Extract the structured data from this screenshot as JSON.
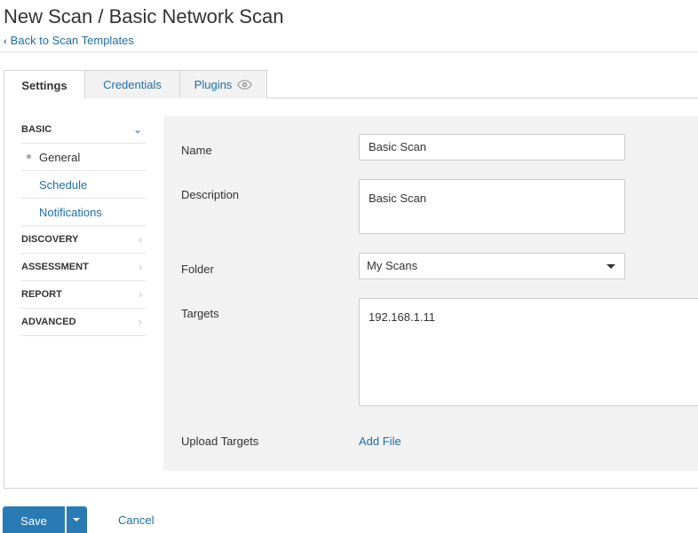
{
  "header": {
    "title": "New Scan / Basic Network Scan",
    "back_link": "Back to Scan Templates"
  },
  "tabs": [
    {
      "label": "Settings",
      "active": true
    },
    {
      "label": "Credentials",
      "active": false
    },
    {
      "label": "Plugins",
      "active": false,
      "icon": "eye-icon"
    }
  ],
  "sidebar": {
    "sections": [
      {
        "label": "BASIC",
        "expanded": true,
        "icon": "chevron-down-icon",
        "items": [
          {
            "label": "General",
            "active": true
          },
          {
            "label": "Schedule",
            "active": false
          },
          {
            "label": "Notifications",
            "active": false
          }
        ]
      },
      {
        "label": "DISCOVERY",
        "expanded": false,
        "icon": "chevron-right-icon"
      },
      {
        "label": "ASSESSMENT",
        "expanded": false,
        "icon": "chevron-right-icon"
      },
      {
        "label": "REPORT",
        "expanded": false,
        "icon": "chevron-right-icon"
      },
      {
        "label": "ADVANCED",
        "expanded": false,
        "icon": "chevron-right-icon"
      }
    ]
  },
  "form": {
    "name": {
      "label": "Name",
      "value": "Basic Scan"
    },
    "description": {
      "label": "Description",
      "value": "Basic Scan"
    },
    "folder": {
      "label": "Folder",
      "value": "My Scans"
    },
    "targets": {
      "label": "Targets",
      "value": "192.168.1.11"
    },
    "upload": {
      "label": "Upload Targets",
      "link": "Add File"
    }
  },
  "footer": {
    "save_label": "Save",
    "cancel_label": "Cancel"
  },
  "colors": {
    "link": "#1d6fad",
    "primary_button": "#2a7ab6",
    "form_background": "#f2f2f2"
  }
}
